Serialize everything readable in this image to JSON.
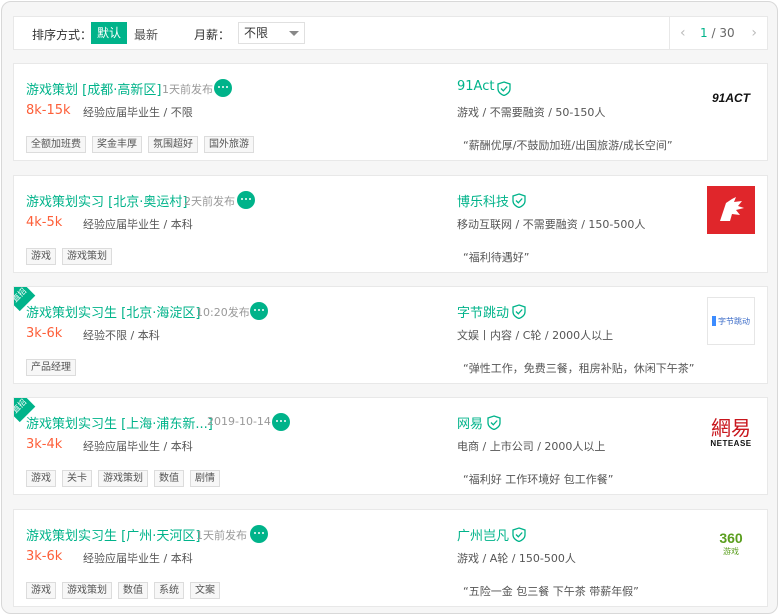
{
  "toolbar": {
    "sort_label": "排序方式：",
    "sort_default": "默认",
    "sort_latest": "最新",
    "salary_label": "月薪：",
    "salary_value": "不限",
    "page_current": "1",
    "page_sep": " / ",
    "page_total": "30",
    "prev_icon": "chevron-left-icon",
    "next_icon": "chevron-right-icon"
  },
  "jobs": [
    {
      "title": "游戏策划 [成都·高新区]",
      "time": "1天前发布",
      "salary": "8k-15k",
      "req": "经验应届毕业生 / 不限",
      "tags": [
        "全额加班费",
        "奖金丰厚",
        "氛围超好",
        "国外旅游"
      ],
      "company": "91Act",
      "industry": "游戏 / 不需要融资 / 50-150人",
      "slogan": "“薪酬优厚/不鼓励加班/出国旅游/成长空间”",
      "logo_text": "91ACT",
      "badge": ""
    },
    {
      "title": "游戏策划实习 [北京·奥运村]",
      "time": "2天前发布",
      "salary": "4k-5k",
      "req": "经验应届毕业生 / 本科",
      "tags": [
        "游戏",
        "游戏策划"
      ],
      "company": "博乐科技",
      "industry": "移动互联网 / 不需要融资 / 150-500人",
      "slogan": "“福利待遇好”",
      "logo_text": "",
      "badge": ""
    },
    {
      "title": "游戏策划实习生 [北京·海淀区]",
      "time": "10:20发布",
      "salary": "3k-6k",
      "req": "经验不限 / 本科",
      "tags": [
        "产品经理"
      ],
      "company": "字节跳动",
      "industry": "文娱丨内容 / C轮 / 2000人以上",
      "slogan": "“弹性工作，免费三餐，租房补贴，休闲下午茶”",
      "logo_text": "字节跳动",
      "badge": "直招"
    },
    {
      "title": "游戏策划实习生 [上海·浦东新...]",
      "time": "2019-10-14",
      "salary": "3k-4k",
      "req": "经验应届毕业生 / 本科",
      "tags": [
        "游戏",
        "关卡",
        "游戏策划",
        "数值",
        "剧情"
      ],
      "company": "网易",
      "industry": "电商 / 上市公司 / 2000人以上",
      "slogan": "“福利好 工作环境好 包工作餐”",
      "logo_text": "網易",
      "logo_sub": "NETEASE",
      "badge": "直招"
    },
    {
      "title": "游戏策划实习生 [广州·天河区]",
      "time": "1天前发布",
      "salary": "3k-6k",
      "req": "经验应届毕业生 / 本科",
      "tags": [
        "游戏",
        "游戏策划",
        "数值",
        "系统",
        "文案"
      ],
      "company": "广州岂凡",
      "industry": "游戏 / A轮 / 150-500人",
      "slogan": "“五险一金 包三餐 下午茶 带薪年假”",
      "logo_text": "360",
      "logo_sub": "游戏",
      "badge": ""
    }
  ],
  "colors": {
    "accent": "#00b38a",
    "salary": "#fd5f39",
    "bo_le_red": "#e0262b",
    "netease_red": "#c8161d"
  }
}
